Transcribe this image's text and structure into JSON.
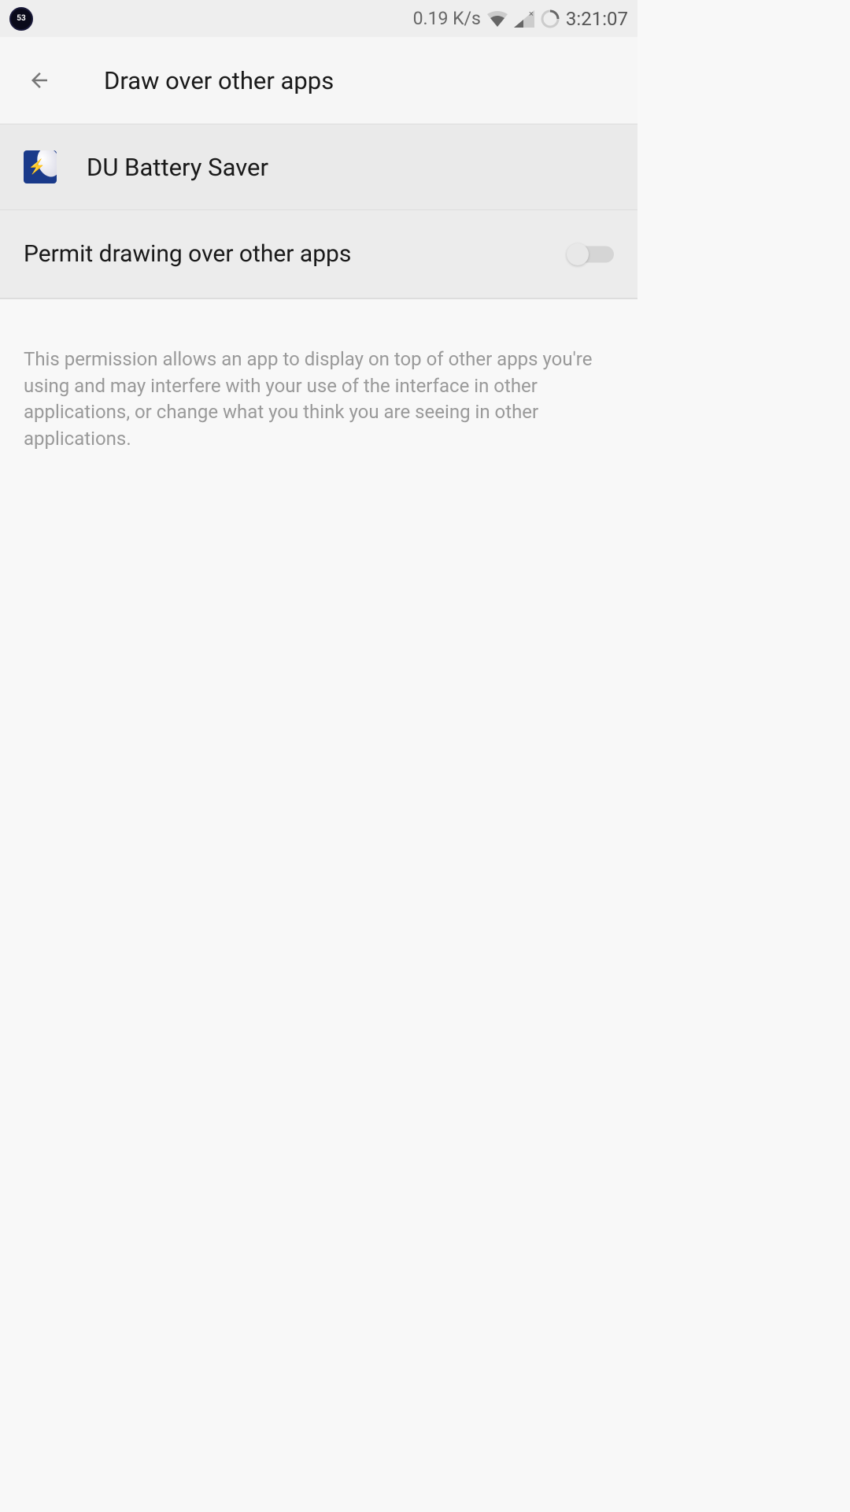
{
  "status_bar": {
    "notification_count": "53",
    "network_speed": "0.19 K/s",
    "clock": "3:21:07"
  },
  "app_bar": {
    "title": "Draw over other apps"
  },
  "app_header": {
    "name": "DU Battery Saver"
  },
  "permission": {
    "label": "Permit drawing over other apps",
    "enabled": false,
    "description": "This permission allows an app to display on top of other apps you're using and may interfere with your use of the interface in other applications, or change what you think you are seeing in other applications."
  }
}
